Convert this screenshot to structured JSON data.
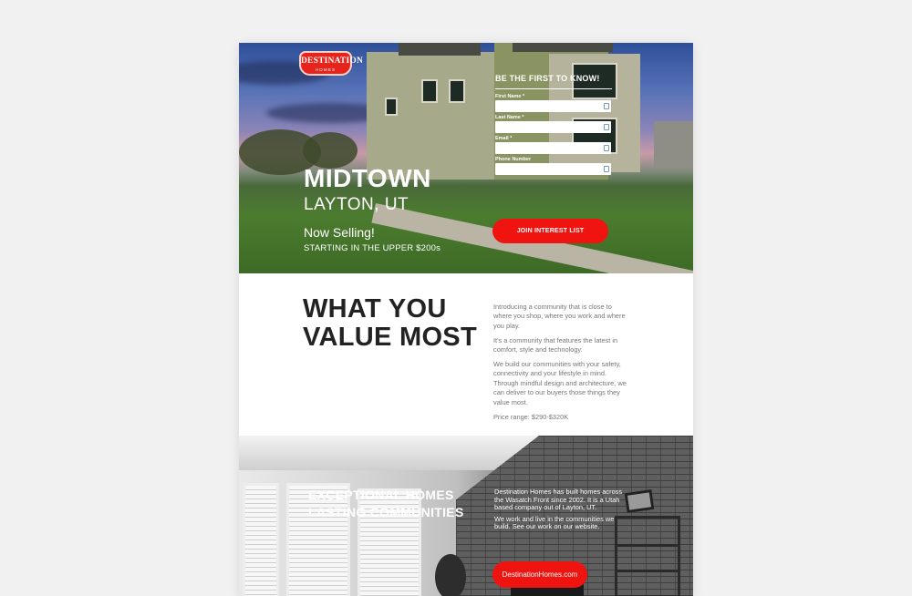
{
  "hero": {
    "logo_line1": "DESTINATION",
    "logo_line2": "HOMES",
    "title": "MIDTOWN",
    "location": "LAYTON, UT",
    "status": "Now Selling!",
    "price_note": "STARTING IN THE UPPER $200s"
  },
  "form": {
    "heading": "BE THE FIRST TO KNOW!",
    "fields": [
      {
        "label": "First Name *",
        "value": ""
      },
      {
        "label": "Last Name *",
        "value": ""
      },
      {
        "label": "Email *",
        "value": ""
      },
      {
        "label": "Phone Number",
        "value": ""
      }
    ],
    "submit_label": "JOIN INTEREST LIST"
  },
  "value": {
    "title": "WHAT YOU VALUE MOST",
    "paragraphs": [
      "Introducing a community that is close to where you shop, where you work and where you play.",
      "It's a community that features the latest in comfort, style and technology.",
      "We build our communities with your safety, connectivity and your lifestyle in mind. Through mindful design and architecture, we can deliver to our buyers those things they value most.",
      "Price range: $290-$320K"
    ]
  },
  "exceptional": {
    "title_line1": "EXCEPTIONAL HOMES",
    "title_line2": "LASTING COMMUNITIES",
    "paragraphs": [
      "Destination Homes has built homes across the Wasatch Front since 2002. It is a Utah based company out of Layton, UT.",
      "We work and live in the communities we build. See our work on our website."
    ],
    "button_label": "DestinationHomes.com"
  },
  "colors": {
    "accent": "#ef1410",
    "logo_red": "#e8231c",
    "page_background": "#f1f1f1"
  }
}
